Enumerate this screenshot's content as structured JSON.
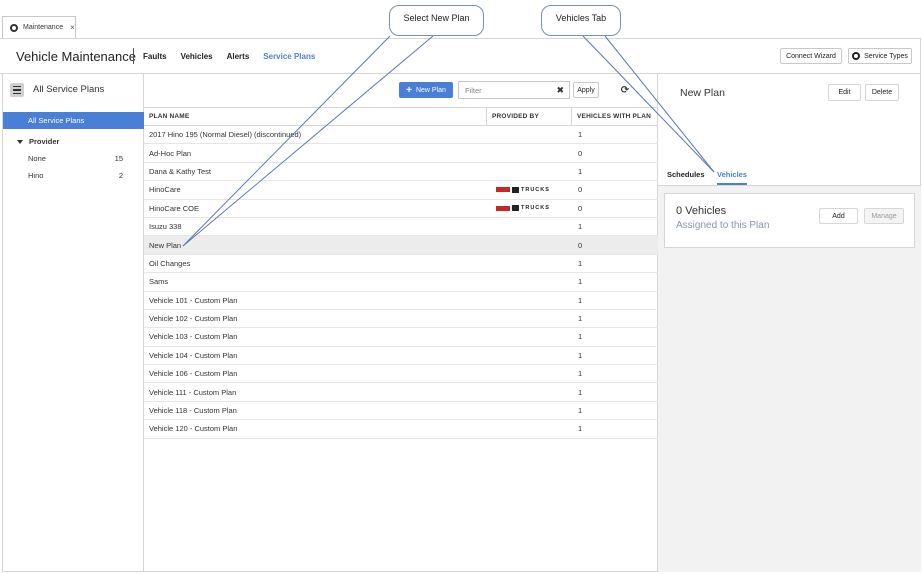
{
  "browser_tab": {
    "label": "Maintenance",
    "close": "×"
  },
  "header": {
    "title": "Vehicle Maintenance",
    "nav": [
      "Faults",
      "Vehicles",
      "Alerts",
      "Service Plans"
    ],
    "active_nav": "Service Plans",
    "connect_wizard": "Connect Wizard",
    "service_types": "Service Types"
  },
  "sidebar": {
    "title": "All Service Plans",
    "selected_item": "All Service Plans",
    "group": "Provider",
    "items": [
      {
        "label": "None",
        "count": "15"
      },
      {
        "label": "Hino",
        "count": "2"
      }
    ]
  },
  "toolbar": {
    "new_plan": "New Plan",
    "new_plan_icon": "+",
    "filter_placeholder": "Filter",
    "clear_icon": "✖",
    "apply": "Apply",
    "refresh_icon": "⟳"
  },
  "table": {
    "columns": [
      "PLAN NAME",
      "PROVIDED BY",
      "VEHICLES WITH PLAN"
    ],
    "provider_logo_text": "TRUCKS",
    "rows": [
      {
        "name": "2017 Hino 195 (Normal Diesel) (discontinued)",
        "provider": "",
        "vehicles": "1"
      },
      {
        "name": "Ad-Hoc Plan",
        "provider": "",
        "vehicles": "0"
      },
      {
        "name": "Dana & Kathy Test",
        "provider": "",
        "vehicles": "1"
      },
      {
        "name": "HinoCare",
        "provider": "Hino Trucks",
        "vehicles": "0"
      },
      {
        "name": "HinoCare COE",
        "provider": "Hino Trucks",
        "vehicles": "0"
      },
      {
        "name": "Isuzu 338",
        "provider": "",
        "vehicles": "1"
      },
      {
        "name": "New Plan",
        "provider": "",
        "vehicles": "0",
        "selected": true
      },
      {
        "name": "Oil Changes",
        "provider": "",
        "vehicles": "1"
      },
      {
        "name": "Sams",
        "provider": "",
        "vehicles": "1"
      },
      {
        "name": "Vehicle 101 - Custom Plan",
        "provider": "",
        "vehicles": "1"
      },
      {
        "name": "Vehicle 102 - Custom Plan",
        "provider": "",
        "vehicles": "1"
      },
      {
        "name": "Vehicle 103 - Custom Plan",
        "provider": "",
        "vehicles": "1"
      },
      {
        "name": "Vehicle 104 - Custom Plan",
        "provider": "",
        "vehicles": "1"
      },
      {
        "name": "Vehicle 106 - Custom Plan",
        "provider": "",
        "vehicles": "1"
      },
      {
        "name": "Vehicle 111 - Custom Plan",
        "provider": "",
        "vehicles": "1"
      },
      {
        "name": "Vehicle 118 - Custom Plan",
        "provider": "",
        "vehicles": "1"
      },
      {
        "name": "Vehicle 120 - Custom Plan",
        "provider": "",
        "vehicles": "1"
      }
    ]
  },
  "detail": {
    "title": "New Plan",
    "edit": "Edit",
    "delete": "Delete",
    "tabs": [
      "Schedules",
      "Vehicles"
    ],
    "active_tab": "Vehicles",
    "count_text": "0 Vehicles",
    "subtext": "Assigned to this Plan",
    "add": "Add",
    "manage": "Manage"
  },
  "callouts": {
    "select_new_plan": "Select New Plan",
    "vehicles_tab": "Vehicles Tab"
  },
  "colors": {
    "accent": "#4a7fd8",
    "hino_red": "#c62828"
  }
}
